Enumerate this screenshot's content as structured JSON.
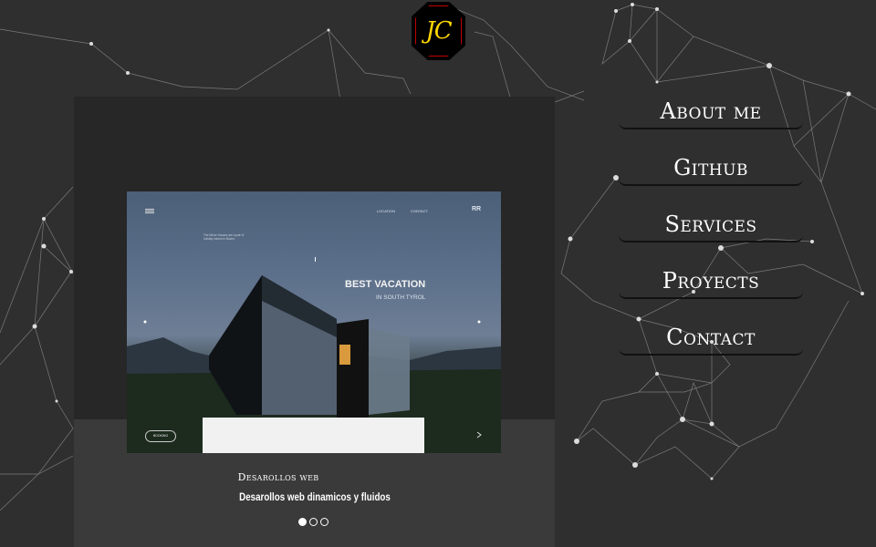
{
  "logo": {
    "text": "JC"
  },
  "menu": {
    "items": [
      {
        "label": "About me"
      },
      {
        "label": "Github"
      },
      {
        "label": "Services"
      },
      {
        "label": "Proyects"
      },
      {
        "label": "Contact"
      }
    ]
  },
  "carousel": {
    "slide": {
      "image_text": {
        "nav_location": "LOCATION",
        "nav_contact": "CONTACT",
        "nav_logo": "RR",
        "headline": "BEST VACATION",
        "subheadline": "IN SOUTH TYROL",
        "description": "The Mirror Houses are a pair of holiday homes in Bozen.",
        "button": "BOOKING"
      },
      "title": "Desarollos web",
      "subtitle": "Desarollos web dinamicos y fluidos"
    },
    "indicators": {
      "count": 3,
      "active_index": 0
    }
  }
}
